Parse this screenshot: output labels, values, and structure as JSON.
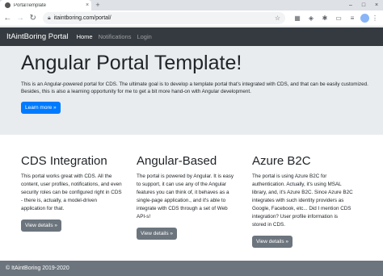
{
  "browser": {
    "tab_title": "PortalTemplate",
    "tab_close": "×",
    "new_tab": "+",
    "url": "itaintboring.com/portal/",
    "window_controls": [
      "–",
      "□",
      "×"
    ]
  },
  "navbar": {
    "brand": "ItAintBoring Portal",
    "links": [
      {
        "label": "Home",
        "active": true
      },
      {
        "label": "Notifications",
        "active": false
      },
      {
        "label": "Login",
        "active": false
      }
    ]
  },
  "jumbotron": {
    "title": "Angular Portal Template!",
    "text": "This is an Angular-powered portal for CDS. The ultimate goal is to develop a template portal that's integrated with CDS, and that can be easily customized. Besides, this is also a learning opportunity for me to get a bit more hand-on with Angular development.",
    "button": "Learn more »"
  },
  "columns": [
    {
      "title": "CDS Integration",
      "text": "This portal works great with CDS. All the content, user profiles, notifications, and even security roles can be configured right in CDS - there is, actually, a model-driven application for that.",
      "button": "View details »"
    },
    {
      "title": "Angular-Based",
      "text": "The portal is powered by Angular. It is easy to support, it can use any of the Angular features you can think of, it behaves as a single-page application., and it's able to integrate with CDS through a set of Web API-s!",
      "button": "View details »"
    },
    {
      "title": "Azure B2C",
      "text": "The portal is using Azure B2C for authentication. Actually, it's using MSAL library, and, it's Azure B2C. Since Azure B2C integrates with such identity providers as Google, Facebook, etc... Did I mention CDS integration? User profile information is stored in CDS.",
      "button": "View details »"
    }
  ],
  "footer": {
    "text": "© ItAintBoring 2019-2020"
  },
  "colors": {
    "navbar_bg": "#343a40",
    "jumbotron_bg": "#e9ecef",
    "primary": "#007bff",
    "secondary": "#6c757d",
    "footer_bg": "#6c757d"
  }
}
